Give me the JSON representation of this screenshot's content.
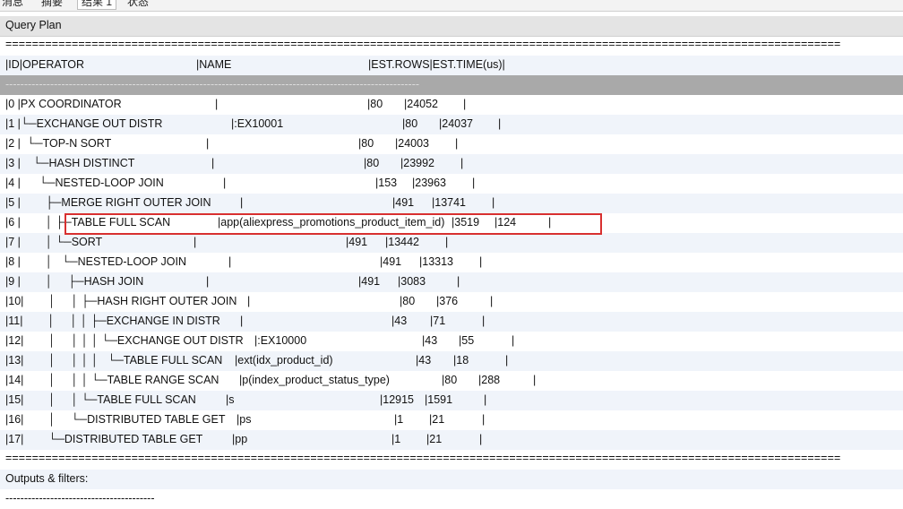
{
  "tabs": [
    "消息",
    "摘要",
    "结果 1",
    "状态"
  ],
  "panel_title": "Query Plan",
  "rule_eq": "==============================================================================================================================",
  "rule_dash": "---------------------------------------------------------------------------------------------------------------",
  "rule_dash_short": "----------------------------------------",
  "columns": {
    "id_op": "|ID|OPERATOR",
    "name": "|NAME",
    "rows_time": "|EST.ROWS|EST.TIME(us)|"
  },
  "rows": [
    {
      "a": "|0 |PX COORDINATOR",
      "b": "|",
      "c": "|80",
      "d": "|24052",
      "e": "|"
    },
    {
      "a": "|1 |└─EXCHANGE OUT DISTR",
      "b": "|:EX10001",
      "c": "|80",
      "d": "|24037",
      "e": "|"
    },
    {
      "a": "|2 |  └─TOP-N SORT",
      "b": "|",
      "c": "|80",
      "d": "|24003",
      "e": "|"
    },
    {
      "a": "|3 |    └─HASH DISTINCT",
      "b": "|",
      "c": "|80",
      "d": "|23992",
      "e": "|"
    },
    {
      "a": "|4 |      └─NESTED-LOOP JOIN",
      "b": "|",
      "c": "|153",
      "d": "|23963",
      "e": "|"
    },
    {
      "a": "|5 |        ├─MERGE RIGHT OUTER JOIN",
      "b": "|",
      "c": "|491",
      "d": "|13741",
      "e": "|"
    },
    {
      "a": "|6 |        │ ├─TABLE FULL SCAN",
      "b": "|app(aliexpress_promotions_product_item_id)",
      "c": "|3519",
      "d": "|124",
      "e": "|"
    },
    {
      "a": "|7 |        │ └─SORT",
      "b": "|",
      "c": "|491",
      "d": "|13442",
      "e": "|"
    },
    {
      "a": "|8 |        │   └─NESTED-LOOP JOIN",
      "b": "|",
      "c": "|491",
      "d": "|13313",
      "e": "|"
    },
    {
      "a": "|9 |        │     ├─HASH JOIN",
      "b": "|",
      "c": "|491",
      "d": "|3083",
      "e": "|"
    },
    {
      "a": "|10|        │     │ ├─HASH RIGHT OUTER JOIN",
      "b": "|",
      "c": "|80",
      "d": "|376",
      "e": "|"
    },
    {
      "a": "|11|        │     │ │ ├─EXCHANGE IN DISTR",
      "b": "|",
      "c": "|43",
      "d": "|71",
      "e": "|"
    },
    {
      "a": "|12|        │     │ │ │ └─EXCHANGE OUT DISTR",
      "b": "|:EX10000",
      "c": "|43",
      "d": "|55",
      "e": "|"
    },
    {
      "a": "|13|        │     │ │ │   └─TABLE FULL SCAN",
      "b": "|ext(idx_product_id)",
      "c": "|43",
      "d": "|18",
      "e": "|"
    },
    {
      "a": "|14|        │     │ │ └─TABLE RANGE SCAN",
      "b": "|p(index_product_status_type)",
      "c": "|80",
      "d": "|288",
      "e": "|"
    },
    {
      "a": "|15|        │     │ └─TABLE FULL SCAN",
      "b": "|s",
      "c": "|12915",
      "d": "|1591",
      "e": "|"
    },
    {
      "a": "|16|        │     └─DISTRIBUTED TABLE GET",
      "b": "|ps",
      "c": "|1",
      "d": "|21",
      "e": "|"
    },
    {
      "a": "|17|        └─DISTRIBUTED TABLE GET",
      "b": "|pp",
      "c": "|1",
      "d": "|21",
      "e": "|"
    }
  ],
  "outputs_label": "Outputs & filters:"
}
